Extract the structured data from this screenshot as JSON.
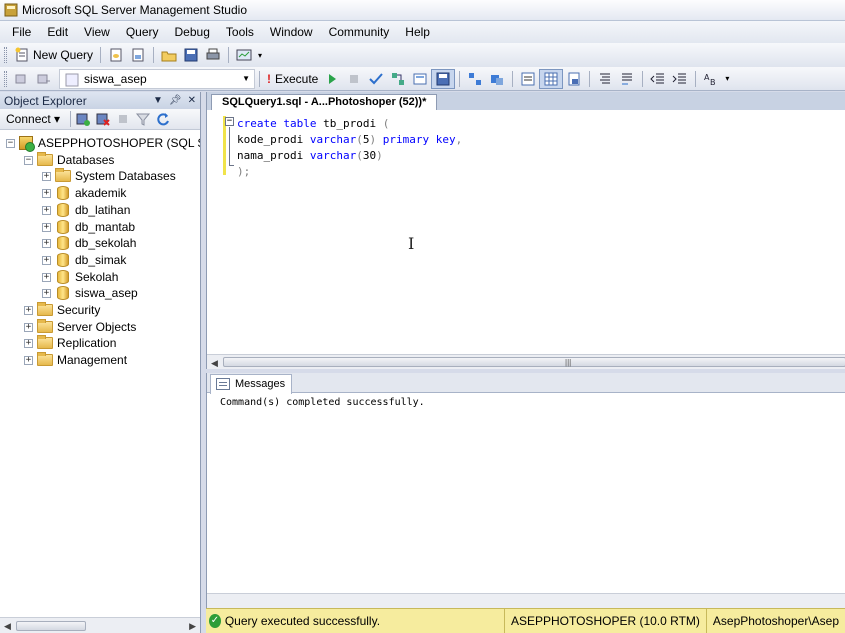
{
  "window": {
    "title": "Microsoft SQL Server Management Studio"
  },
  "menu": [
    "File",
    "Edit",
    "View",
    "Query",
    "Debug",
    "Tools",
    "Window",
    "Community",
    "Help"
  ],
  "toolbar1": {
    "new_query": "New Query"
  },
  "toolbar2": {
    "database": "siswa_asep",
    "execute": "Execute"
  },
  "object_explorer": {
    "title": "Object Explorer",
    "connect": "Connect",
    "server": "ASEPPHOTOSHOPER (SQL Serve",
    "databases": "Databases",
    "system_databases": "System Databases",
    "db_list": [
      "akademik",
      "db_latihan",
      "db_mantab",
      "db_sekolah",
      "db_simak",
      "Sekolah",
      "siswa_asep"
    ],
    "folders": [
      "Security",
      "Server Objects",
      "Replication",
      "Management"
    ]
  },
  "editor": {
    "tab": "SQLQuery1.sql - A...Photoshoper (52))*",
    "lines": [
      {
        "parts": [
          [
            "kw",
            "create"
          ],
          [
            "",
            " "
          ],
          [
            "kw",
            "table"
          ],
          [
            "",
            " tb_prodi "
          ],
          [
            "gray",
            "("
          ]
        ]
      },
      {
        "parts": [
          [
            "",
            "kode_prodi "
          ],
          [
            "kw",
            "varchar"
          ],
          [
            "gray",
            "("
          ],
          [
            "",
            "5"
          ],
          [
            "gray",
            ")"
          ],
          [
            "",
            " "
          ],
          [
            "kw",
            "primary key"
          ],
          [
            "gray",
            ","
          ]
        ]
      },
      {
        "parts": [
          [
            "",
            "nama_prodi "
          ],
          [
            "kw",
            "varchar"
          ],
          [
            "gray",
            "("
          ],
          [
            "",
            "30"
          ],
          [
            "gray",
            ")"
          ]
        ]
      },
      {
        "parts": [
          [
            "gray",
            ");"
          ]
        ]
      }
    ]
  },
  "results": {
    "tab": "Messages",
    "message": "Command(s) completed successfully."
  },
  "status": {
    "message": "Query executed successfully.",
    "server": "ASEPPHOTOSHOPER (10.0 RTM)",
    "user": "AsepPhotoshoper\\Asep"
  }
}
